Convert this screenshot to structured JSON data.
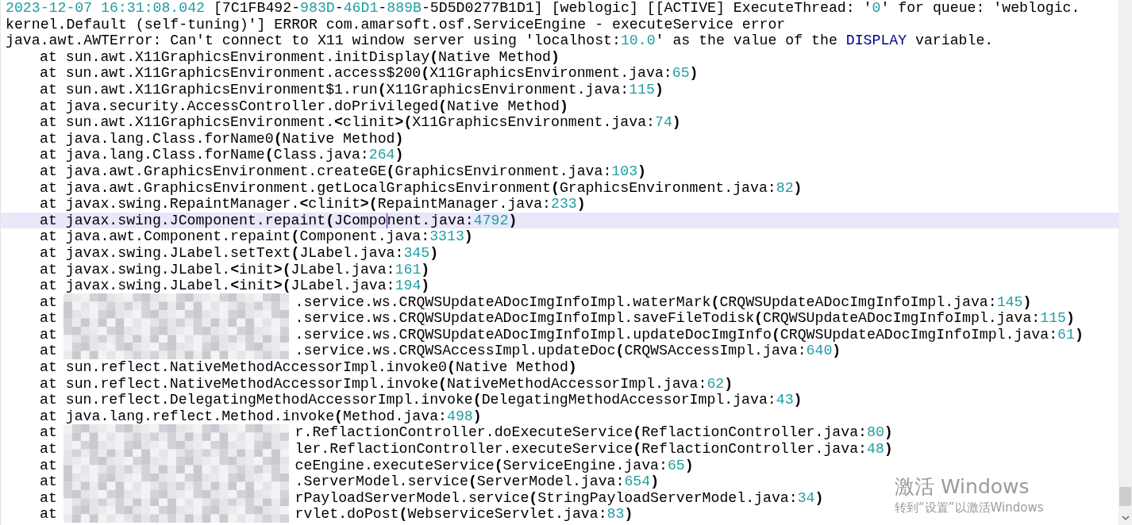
{
  "editor": {
    "lines": [
      {
        "kind": "message",
        "current": false,
        "segments": [
          {
            "kind": "num",
            "text": "2023-12-07 16:31:08.042"
          },
          {
            "kind": "plain",
            "text": " [7C1FB492-"
          },
          {
            "kind": "num",
            "text": "983D"
          },
          {
            "kind": "plain",
            "text": "-"
          },
          {
            "kind": "num",
            "text": "46D1"
          },
          {
            "kind": "plain",
            "text": "-"
          },
          {
            "kind": "num",
            "text": "889B"
          },
          {
            "kind": "plain",
            "text": "-5D5D0277B1D1] [weblogic] [[ACTIVE] ExecuteThread: '"
          },
          {
            "kind": "num",
            "text": "0"
          },
          {
            "kind": "plain",
            "text": "' for queue: 'weblogic."
          }
        ]
      },
      {
        "kind": "message",
        "current": false,
        "segments": [
          {
            "kind": "plain",
            "text": "kernel.Default (self-tuning)'] ERROR com.amarsoft.osf.ServiceEngine - executeService error"
          }
        ]
      },
      {
        "kind": "message",
        "current": false,
        "segments": [
          {
            "kind": "plain",
            "text": "java.awt.AWTError: Can't connect to X11 window server using 'localhost:"
          },
          {
            "kind": "num",
            "text": "10.0"
          },
          {
            "kind": "plain",
            "text": "' as the value of the "
          },
          {
            "kind": "kw",
            "text": "DISPLAY"
          },
          {
            "kind": "plain",
            "text": " variable."
          }
        ]
      },
      {
        "kind": "frame",
        "current": false,
        "segments": [
          {
            "kind": "plain",
            "text": "at sun.awt.X11GraphicsEnvironment.initDisplay"
          },
          {
            "kind": "op",
            "text": "("
          },
          {
            "kind": "plain",
            "text": "Native Method"
          },
          {
            "kind": "op",
            "text": ")"
          }
        ]
      },
      {
        "kind": "frame",
        "current": false,
        "segments": [
          {
            "kind": "plain",
            "text": "at sun.awt.X11GraphicsEnvironment.access$200"
          },
          {
            "kind": "op",
            "text": "("
          },
          {
            "kind": "plain",
            "text": "X11GraphicsEnvironment.java:"
          },
          {
            "kind": "num",
            "text": "65"
          },
          {
            "kind": "op",
            "text": ")"
          }
        ]
      },
      {
        "kind": "frame",
        "current": false,
        "segments": [
          {
            "kind": "plain",
            "text": "at sun.awt.X11GraphicsEnvironment$1.run"
          },
          {
            "kind": "op",
            "text": "("
          },
          {
            "kind": "plain",
            "text": "X11GraphicsEnvironment.java:"
          },
          {
            "kind": "num",
            "text": "115"
          },
          {
            "kind": "op",
            "text": ")"
          }
        ]
      },
      {
        "kind": "frame",
        "current": false,
        "segments": [
          {
            "kind": "plain",
            "text": "at java.security.AccessController.doPrivileged"
          },
          {
            "kind": "op",
            "text": "("
          },
          {
            "kind": "plain",
            "text": "Native Method"
          },
          {
            "kind": "op",
            "text": ")"
          }
        ]
      },
      {
        "kind": "frame",
        "current": false,
        "segments": [
          {
            "kind": "plain",
            "text": "at sun.awt.X11GraphicsEnvironment."
          },
          {
            "kind": "op",
            "text": "<"
          },
          {
            "kind": "plain",
            "text": "clinit"
          },
          {
            "kind": "op",
            "text": ">("
          },
          {
            "kind": "plain",
            "text": "X11GraphicsEnvironment.java:"
          },
          {
            "kind": "num",
            "text": "74"
          },
          {
            "kind": "op",
            "text": ")"
          }
        ]
      },
      {
        "kind": "frame",
        "current": false,
        "segments": [
          {
            "kind": "plain",
            "text": "at java.lang.Class.forName0"
          },
          {
            "kind": "op",
            "text": "("
          },
          {
            "kind": "plain",
            "text": "Native Method"
          },
          {
            "kind": "op",
            "text": ")"
          }
        ]
      },
      {
        "kind": "frame",
        "current": false,
        "segments": [
          {
            "kind": "plain",
            "text": "at java.lang.Class.forName"
          },
          {
            "kind": "op",
            "text": "("
          },
          {
            "kind": "plain",
            "text": "Class.java:"
          },
          {
            "kind": "num",
            "text": "264"
          },
          {
            "kind": "op",
            "text": ")"
          }
        ]
      },
      {
        "kind": "frame",
        "current": false,
        "segments": [
          {
            "kind": "plain",
            "text": "at java.awt.GraphicsEnvironment.createGE"
          },
          {
            "kind": "op",
            "text": "("
          },
          {
            "kind": "plain",
            "text": "GraphicsEnvironment.java:"
          },
          {
            "kind": "num",
            "text": "103"
          },
          {
            "kind": "op",
            "text": ")"
          }
        ]
      },
      {
        "kind": "frame",
        "current": false,
        "segments": [
          {
            "kind": "plain",
            "text": "at java.awt.GraphicsEnvironment.getLocalGraphicsEnvironment"
          },
          {
            "kind": "op",
            "text": "("
          },
          {
            "kind": "plain",
            "text": "GraphicsEnvironment.java:"
          },
          {
            "kind": "num",
            "text": "82"
          },
          {
            "kind": "op",
            "text": ")"
          }
        ]
      },
      {
        "kind": "frame",
        "current": false,
        "segments": [
          {
            "kind": "plain",
            "text": "at javax.swing.RepaintManager."
          },
          {
            "kind": "op",
            "text": "<"
          },
          {
            "kind": "plain",
            "text": "clinit"
          },
          {
            "kind": "op",
            "text": ">("
          },
          {
            "kind": "plain",
            "text": "RepaintManager.java:"
          },
          {
            "kind": "num",
            "text": "233"
          },
          {
            "kind": "op",
            "text": ")"
          }
        ]
      },
      {
        "kind": "frame",
        "current": true,
        "segments": [
          {
            "kind": "plain",
            "text": "at javax.swing.JComponent.repaint"
          },
          {
            "kind": "op",
            "text": "("
          },
          {
            "kind": "plain",
            "text": "JCompo"
          },
          {
            "kind": "caret"
          },
          {
            "kind": "plain",
            "text": "nent.java:"
          },
          {
            "kind": "num",
            "text": "4792"
          },
          {
            "kind": "op",
            "text": ")"
          }
        ]
      },
      {
        "kind": "frame",
        "current": false,
        "segments": [
          {
            "kind": "plain",
            "text": "at java.awt.Component.repaint"
          },
          {
            "kind": "op",
            "text": "("
          },
          {
            "kind": "plain",
            "text": "Component.java:"
          },
          {
            "kind": "num",
            "text": "3313"
          },
          {
            "kind": "op",
            "text": ")"
          }
        ]
      },
      {
        "kind": "frame",
        "current": false,
        "segments": [
          {
            "kind": "plain",
            "text": "at javax.swing.JLabel.setText"
          },
          {
            "kind": "op",
            "text": "("
          },
          {
            "kind": "plain",
            "text": "JLabel.java:"
          },
          {
            "kind": "num",
            "text": "345"
          },
          {
            "kind": "op",
            "text": ")"
          }
        ]
      },
      {
        "kind": "frame",
        "current": false,
        "segments": [
          {
            "kind": "plain",
            "text": "at javax.swing.JLabel."
          },
          {
            "kind": "op",
            "text": "<"
          },
          {
            "kind": "plain",
            "text": "init"
          },
          {
            "kind": "op",
            "text": ">("
          },
          {
            "kind": "plain",
            "text": "JLabel.java:"
          },
          {
            "kind": "num",
            "text": "161"
          },
          {
            "kind": "op",
            "text": ")"
          }
        ]
      },
      {
        "kind": "frame",
        "current": false,
        "segments": [
          {
            "kind": "plain",
            "text": "at javax.swing.JLabel."
          },
          {
            "kind": "op",
            "text": "<"
          },
          {
            "kind": "plain",
            "text": "init"
          },
          {
            "kind": "op",
            "text": ">("
          },
          {
            "kind": "plain",
            "text": "JLabel.java:"
          },
          {
            "kind": "num",
            "text": "194"
          },
          {
            "kind": "op",
            "text": ")"
          }
        ]
      },
      {
        "kind": "frame",
        "current": false,
        "segments": [
          {
            "kind": "plain",
            "text": "at"
          },
          {
            "kind": "redacted"
          },
          {
            "kind": "plain",
            "text": ".service.ws.CRQWSUpdateADocImgInfoImpl.waterMark"
          },
          {
            "kind": "op",
            "text": "("
          },
          {
            "kind": "plain",
            "text": "CRQWSUpdateADocImgInfoImpl.java:"
          },
          {
            "kind": "num",
            "text": "145"
          },
          {
            "kind": "op",
            "text": ")"
          }
        ]
      },
      {
        "kind": "frame",
        "current": false,
        "segments": [
          {
            "kind": "plain",
            "text": "at"
          },
          {
            "kind": "redacted"
          },
          {
            "kind": "plain",
            "text": ".service.ws.CRQWSUpdateADocImgInfoImpl.saveFileTodisk"
          },
          {
            "kind": "op",
            "text": "("
          },
          {
            "kind": "plain",
            "text": "CRQWSUpdateADocImgInfoImpl.java:"
          },
          {
            "kind": "num",
            "text": "115"
          },
          {
            "kind": "op",
            "text": ")"
          }
        ]
      },
      {
        "kind": "frame",
        "current": false,
        "segments": [
          {
            "kind": "plain",
            "text": "at"
          },
          {
            "kind": "redacted"
          },
          {
            "kind": "plain",
            "text": ".service.ws.CRQWSUpdateADocImgInfoImpl.updateDocImgInfo"
          },
          {
            "kind": "op",
            "text": "("
          },
          {
            "kind": "plain",
            "text": "CRQWSUpdateADocImgInfoImpl.java:"
          },
          {
            "kind": "num",
            "text": "61"
          },
          {
            "kind": "op",
            "text": ")"
          }
        ]
      },
      {
        "kind": "frame",
        "current": false,
        "segments": [
          {
            "kind": "plain",
            "text": "at"
          },
          {
            "kind": "redacted"
          },
          {
            "kind": "plain",
            "text": ".service.ws.CRQWSAccessImpl.updateDoc"
          },
          {
            "kind": "op",
            "text": "("
          },
          {
            "kind": "plain",
            "text": "CRQWSAccessImpl.java:"
          },
          {
            "kind": "num",
            "text": "640"
          },
          {
            "kind": "op",
            "text": ")"
          }
        ]
      },
      {
        "kind": "frame",
        "current": false,
        "segments": [
          {
            "kind": "plain",
            "text": "at sun.reflect.NativeMethodAccessorImpl.invoke0"
          },
          {
            "kind": "op",
            "text": "("
          },
          {
            "kind": "plain",
            "text": "Native Method"
          },
          {
            "kind": "op",
            "text": ")"
          }
        ]
      },
      {
        "kind": "frame",
        "current": false,
        "segments": [
          {
            "kind": "plain",
            "text": "at sun.reflect.NativeMethodAccessorImpl.invoke"
          },
          {
            "kind": "op",
            "text": "("
          },
          {
            "kind": "plain",
            "text": "NativeMethodAccessorImpl.java:"
          },
          {
            "kind": "num",
            "text": "62"
          },
          {
            "kind": "op",
            "text": ")"
          }
        ]
      },
      {
        "kind": "frame",
        "current": false,
        "segments": [
          {
            "kind": "plain",
            "text": "at sun.reflect.DelegatingMethodAccessorImpl.invoke"
          },
          {
            "kind": "op",
            "text": "("
          },
          {
            "kind": "plain",
            "text": "DelegatingMethodAccessorImpl.java:"
          },
          {
            "kind": "num",
            "text": "43"
          },
          {
            "kind": "op",
            "text": ")"
          }
        ]
      },
      {
        "kind": "frame",
        "current": false,
        "segments": [
          {
            "kind": "plain",
            "text": "at java.lang.reflect.Method.invoke"
          },
          {
            "kind": "op",
            "text": "("
          },
          {
            "kind": "plain",
            "text": "Method.java:"
          },
          {
            "kind": "num",
            "text": "498"
          },
          {
            "kind": "op",
            "text": ")"
          }
        ]
      },
      {
        "kind": "frame",
        "current": false,
        "segments": [
          {
            "kind": "plain",
            "text": "at"
          },
          {
            "kind": "redacted"
          },
          {
            "kind": "plain",
            "text": "r.ReflactionController.doExecuteService"
          },
          {
            "kind": "op",
            "text": "("
          },
          {
            "kind": "plain",
            "text": "ReflactionController.java:"
          },
          {
            "kind": "num",
            "text": "80"
          },
          {
            "kind": "op",
            "text": ")"
          }
        ]
      },
      {
        "kind": "frame",
        "current": false,
        "segments": [
          {
            "kind": "plain",
            "text": "at"
          },
          {
            "kind": "redacted"
          },
          {
            "kind": "plain",
            "text": "ler.ReflactionController.executeService"
          },
          {
            "kind": "op",
            "text": "("
          },
          {
            "kind": "plain",
            "text": "ReflactionController.java:"
          },
          {
            "kind": "num",
            "text": "48"
          },
          {
            "kind": "op",
            "text": ")"
          }
        ]
      },
      {
        "kind": "frame",
        "current": false,
        "segments": [
          {
            "kind": "plain",
            "text": "at"
          },
          {
            "kind": "redacted"
          },
          {
            "kind": "plain",
            "text": "ceEngine.executeService"
          },
          {
            "kind": "op",
            "text": "("
          },
          {
            "kind": "plain",
            "text": "ServiceEngine.java:"
          },
          {
            "kind": "num",
            "text": "65"
          },
          {
            "kind": "op",
            "text": ")"
          }
        ]
      },
      {
        "kind": "frame",
        "current": false,
        "segments": [
          {
            "kind": "plain",
            "text": "at"
          },
          {
            "kind": "redacted"
          },
          {
            "kind": "plain",
            "text": ".ServerModel.service"
          },
          {
            "kind": "op",
            "text": "("
          },
          {
            "kind": "plain",
            "text": "ServerModel.java:"
          },
          {
            "kind": "num",
            "text": "654"
          },
          {
            "kind": "op",
            "text": ")"
          }
        ]
      },
      {
        "kind": "frame",
        "current": false,
        "segments": [
          {
            "kind": "plain",
            "text": "at"
          },
          {
            "kind": "redacted"
          },
          {
            "kind": "plain",
            "text": "rPayloadServerModel.service"
          },
          {
            "kind": "op",
            "text": "("
          },
          {
            "kind": "plain",
            "text": "StringPayloadServerModel.java:"
          },
          {
            "kind": "num",
            "text": "34"
          },
          {
            "kind": "op",
            "text": ")"
          }
        ]
      },
      {
        "kind": "frame",
        "current": false,
        "segments": [
          {
            "kind": "plain",
            "text": "at"
          },
          {
            "kind": "redacted"
          },
          {
            "kind": "plain",
            "text": "rvlet.doPost"
          },
          {
            "kind": "op",
            "text": "("
          },
          {
            "kind": "plain",
            "text": "WebserviceServlet.java:"
          },
          {
            "kind": "num",
            "text": "83"
          },
          {
            "kind": "op",
            "text": ")"
          }
        ]
      }
    ]
  },
  "activation_notice": {
    "title": "激活 Windows",
    "hint": "转到“设置”以激活Windows"
  }
}
